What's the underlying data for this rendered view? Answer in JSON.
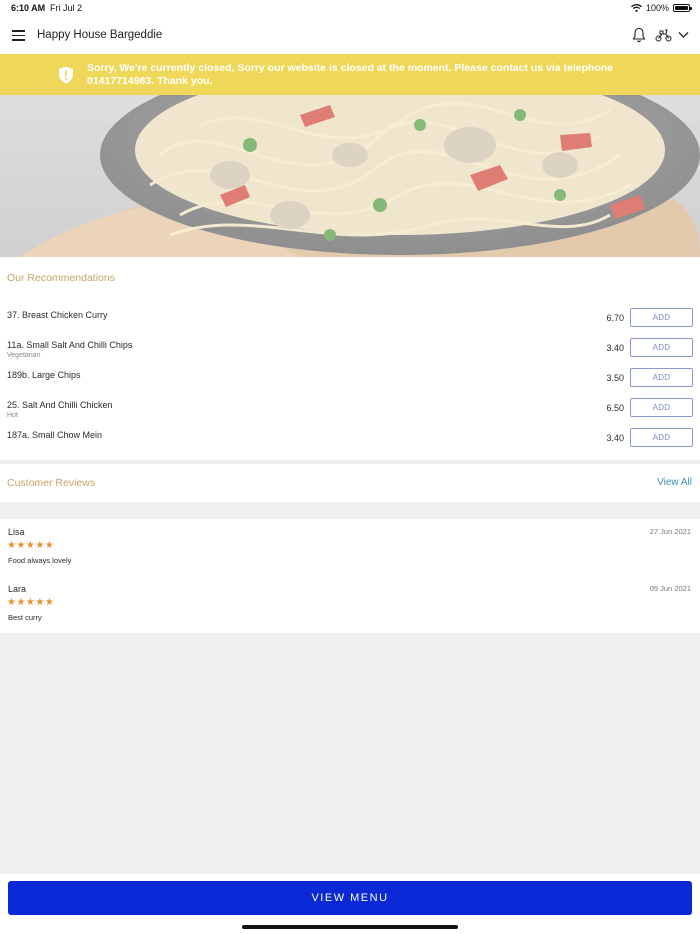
{
  "status_bar": {
    "time": "6:10 AM",
    "date": "Fri Jul 2",
    "battery": "100%"
  },
  "header": {
    "title": "Happy House Bargeddie",
    "icons": [
      "menu-icon",
      "bell-icon",
      "scooter-icon",
      "chevron-down-icon"
    ]
  },
  "banner": {
    "message": "Sorry, We're currently closed, Sorry our website is closed at the moment. Please contact us via telephone 01417714983. Thank you.",
    "color": "#efd859"
  },
  "recommendations": {
    "title": "Our Recommendations",
    "add_label": "ADD",
    "items": [
      {
        "name": "37. Breast Chicken Curry",
        "tag": "",
        "price": "6.70"
      },
      {
        "name": "11a. Small Salt And Chilli Chips",
        "tag": "Vegetarian",
        "price": "3.40"
      },
      {
        "name": "189b. Large Chips",
        "tag": "",
        "price": "3.50"
      },
      {
        "name": "25. Salt And Chilli Chicken",
        "tag": "Hot",
        "price": "6.50"
      },
      {
        "name": "187a. Small Chow Mein",
        "tag": "",
        "price": "3.40"
      }
    ]
  },
  "reviews": {
    "title": "Customer Reviews",
    "view_all": "View All",
    "items": [
      {
        "author": "Lisa",
        "date": "27 Jun 2021",
        "rating": 5,
        "stars": "★★★★★",
        "comment": "Food always lovely"
      },
      {
        "author": "Lara",
        "date": "05 Jun 2021",
        "rating": 5,
        "stars": "★★★★★",
        "comment": "Best curry"
      }
    ]
  },
  "footer": {
    "view_menu": "VIEW MENU",
    "button_color": "#0a28d6"
  },
  "colors": {
    "accent_title": "#c8a268",
    "link": "#3a8fb0",
    "star": "#e8912f"
  }
}
